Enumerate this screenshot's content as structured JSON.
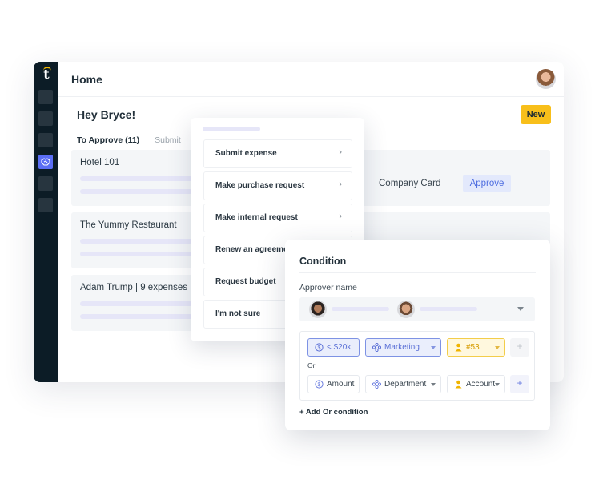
{
  "app": {
    "title": "Home",
    "greeting": "Hey Bryce!",
    "new_button": "New",
    "tabs": [
      {
        "label": "To Approve (11)",
        "active": true
      },
      {
        "label": "Submit",
        "active": false
      }
    ],
    "sidebar": {
      "icons": [
        "nav-item",
        "nav-item",
        "nav-item",
        "handshake-icon",
        "nav-item",
        "nav-item"
      ],
      "active_index": 3,
      "accent": "#5b6ef5"
    },
    "rows": [
      {
        "title": "Hotel 101",
        "payment": "Company Card",
        "action": "Approve"
      },
      {
        "title": "The Yummy Restaurant"
      },
      {
        "title": "Adam Trump | 9 expenses"
      }
    ]
  },
  "menu": {
    "items": [
      {
        "label": "Submit expense"
      },
      {
        "label": "Make purchase request"
      },
      {
        "label": "Make internal request"
      },
      {
        "label": "Renew an agreement"
      },
      {
        "label": "Request budget"
      },
      {
        "label": "I'm not sure"
      }
    ],
    "chevron": "›"
  },
  "condition": {
    "title": "Condition",
    "approver_label": "Approver name",
    "rule_rows": [
      [
        {
          "icon": "dollar-icon",
          "label": "< $20k",
          "style": "blue",
          "dropdown": false
        },
        {
          "icon": "department-icon",
          "label": "Marketing",
          "style": "blue",
          "dropdown": true
        },
        {
          "icon": "person-icon",
          "label": "#53",
          "style": "yellow",
          "dropdown": true
        },
        {
          "icon": "plus-icon",
          "label": "+",
          "style": "plus",
          "dropdown": false
        }
      ],
      [
        {
          "icon": "dollar-icon",
          "label": "Amount",
          "style": "plain",
          "dropdown": false
        },
        {
          "icon": "department-icon",
          "label": "Department",
          "style": "plain",
          "dropdown": true
        },
        {
          "icon": "person-icon",
          "label": "Account",
          "style": "plain",
          "dropdown": true
        },
        {
          "icon": "plus-icon",
          "label": "+",
          "style": "plus2",
          "dropdown": false
        }
      ]
    ],
    "or_label": "Or",
    "add_or": "+ Add Or condition"
  },
  "colors": {
    "brand_yellow": "#f8bf1a",
    "accent_blue": "#5b6ef5",
    "sidebar_bg": "#0c1c26"
  }
}
